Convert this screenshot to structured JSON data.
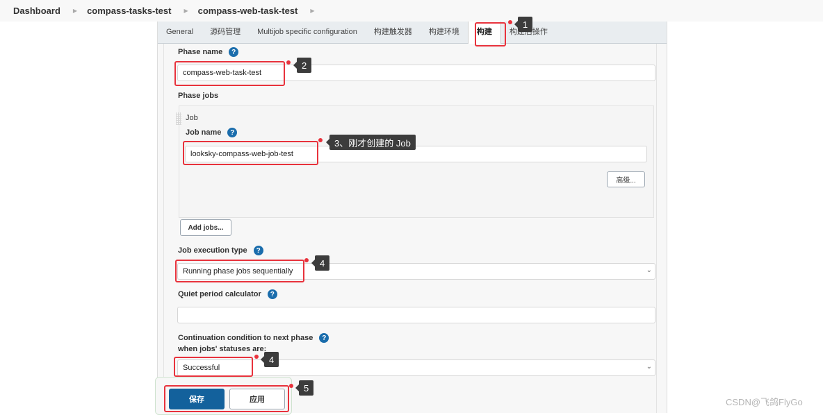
{
  "breadcrumb": [
    "Dashboard",
    "compass-tasks-test",
    "compass-web-task-test"
  ],
  "tabs": [
    {
      "label": "General",
      "active": false
    },
    {
      "label": "源码管理",
      "active": false
    },
    {
      "label": "Multijob specific configuration",
      "active": false
    },
    {
      "label": "构建触发器",
      "active": false
    },
    {
      "label": "构建环境",
      "active": false
    },
    {
      "label": "构建",
      "active": true
    },
    {
      "label": "构建后操作",
      "active": false
    }
  ],
  "form": {
    "phase_name_label": "Phase name",
    "phase_name_value": "compass-web-task-test",
    "phase_jobs_label": "Phase jobs",
    "job_header": "Job",
    "job_name_label": "Job name",
    "job_name_value": "looksky-compass-web-job-test",
    "advanced_button": "高级...",
    "add_jobs_button": "Add jobs...",
    "execution_type_label": "Job execution type",
    "execution_type_value": "Running phase jobs sequentially",
    "quiet_period_label": "Quiet period calculator",
    "quiet_period_value": "",
    "continuation_label_1": "Continuation condition to next phase",
    "continuation_label_2": "when jobs' statuses are:",
    "continuation_value": "Successful",
    "help_glyph": "?",
    "select_arrow_glyph": "⌄"
  },
  "actions": {
    "save": "保存",
    "apply": "应用"
  },
  "annotations": {
    "badge_1": "1",
    "badge_2": "2",
    "badge_3": "3、刚才创建的 Job",
    "badge_4a": "4",
    "badge_4b": "4",
    "badge_5": "5",
    "highlight_color": "#e8323c"
  },
  "watermark": "CSDN@飞鸽FlyGo",
  "colors": {
    "primary_button": "#13619c",
    "help_icon": "#1b6dac",
    "tab_bar": "#e9edf0"
  }
}
